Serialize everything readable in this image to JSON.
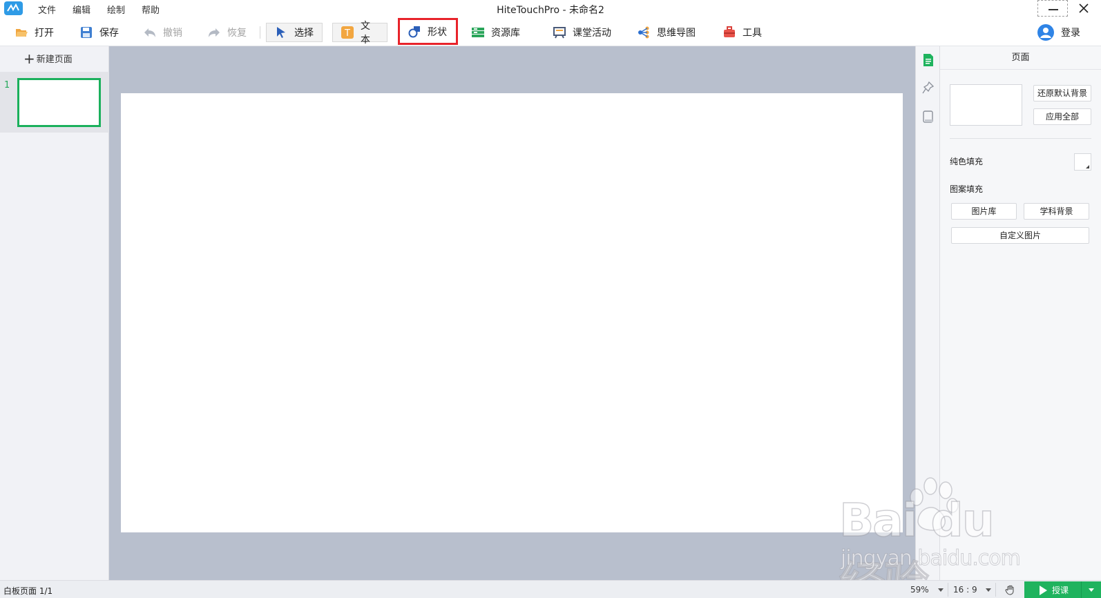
{
  "window": {
    "title": "HiteTouchPro - 未命名2",
    "menu": [
      "文件",
      "编辑",
      "绘制",
      "帮助"
    ]
  },
  "toolbar": {
    "open": "打开",
    "save": "保存",
    "undo": "撤销",
    "redo": "恢复",
    "select": "选择",
    "text": "文本",
    "shape": "形状",
    "resources": "资源库",
    "class_activity": "课堂活动",
    "mindmap": "思维导图",
    "tools": "工具",
    "login": "登录"
  },
  "pages_panel": {
    "new_page": "新建页面",
    "pages": [
      {
        "number": "1"
      }
    ]
  },
  "properties": {
    "title": "页面",
    "restore_default_bg": "还原默认背景",
    "apply_all": "应用全部",
    "solid_fill": "纯色填充",
    "pattern_fill": "图案填充",
    "image_library": "图片库",
    "subject_bg": "学科背景",
    "custom_image": "自定义图片"
  },
  "status": {
    "page_info": "白板页面 1/1",
    "zoom": "59%",
    "aspect": "16 : 9",
    "present": "授课"
  },
  "watermark": {
    "logo": "Bai du 经验",
    "url": "jingyan.baidu.com"
  },
  "colors": {
    "accent_green": "#1fb35e",
    "highlight_red": "#e8232a",
    "canvas_bg": "#b8bfcd"
  },
  "icons": {
    "app": "hitetouch-logo-icon",
    "open": "folder-icon",
    "save": "floppy-icon",
    "undo": "undo-arrow-icon",
    "redo": "redo-arrow-icon",
    "select": "cursor-icon",
    "text": "text-t-icon",
    "shape": "shape-icon",
    "resources": "library-icon",
    "class_activity": "easel-icon",
    "mindmap": "mindmap-icon",
    "tools": "toolbox-icon",
    "login": "user-avatar-icon"
  }
}
